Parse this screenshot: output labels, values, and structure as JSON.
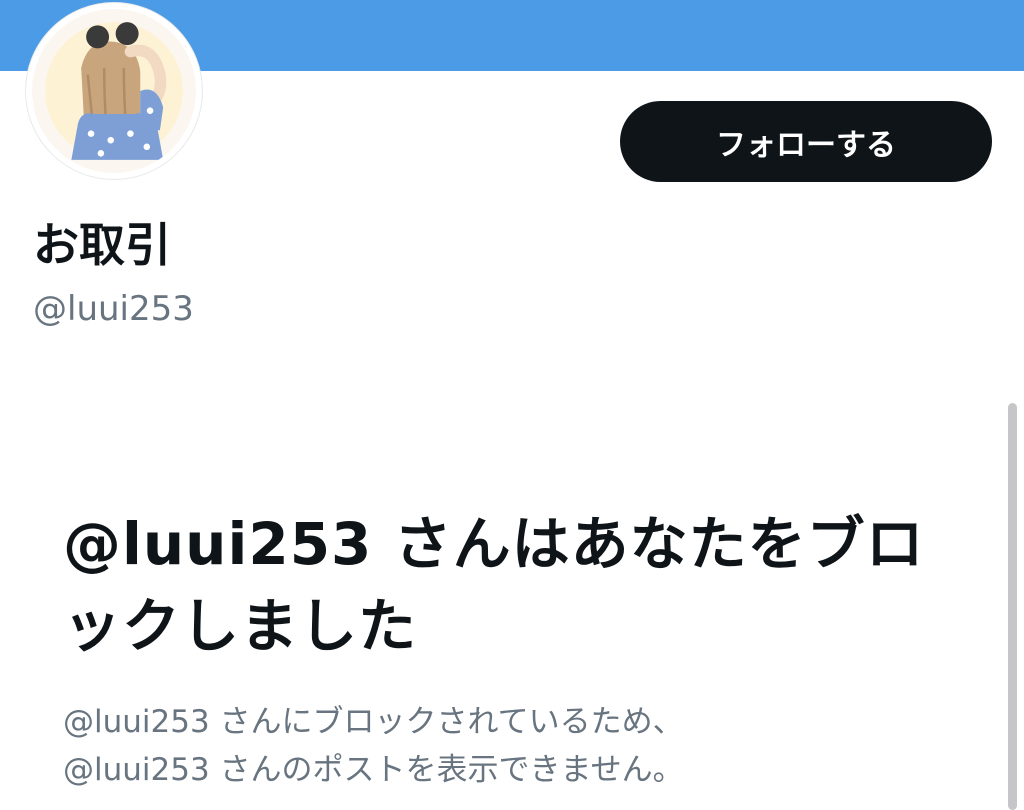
{
  "colors": {
    "banner": "#4c9be6",
    "button_bg": "#0f1419",
    "button_text": "#ffffff",
    "primary_text": "#0f1419",
    "secondary_text": "#687480"
  },
  "profile": {
    "avatar_icon": "profile-picture-girl-illustration",
    "display_name": "お取引",
    "handle": "@luui253",
    "follow_label": "フォローする"
  },
  "blocked_notice": {
    "title": "@luui253 さんはあなたをブロックしました",
    "description_lines": [
      "@luui253 さんにブロックされているため、",
      "@luui253 さんのポストを表示できません。"
    ]
  }
}
